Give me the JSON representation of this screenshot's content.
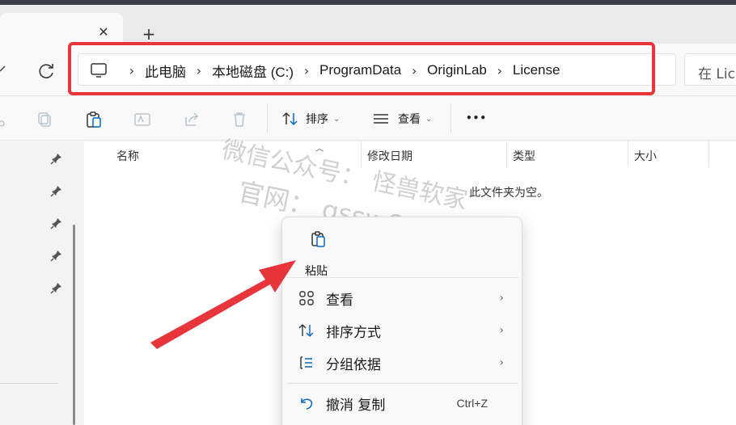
{
  "tab": {
    "close_symbol": "✕",
    "new_symbol": "+"
  },
  "breadcrumbs": [
    "此电脑",
    "本地磁盘 (C:)",
    "ProgramData",
    "OriginLab",
    "License"
  ],
  "breadcrumb_separator": "›",
  "search": {
    "text": "在 Lice"
  },
  "toolbar": {
    "sort_label": "排序",
    "view_label": "查看",
    "more_label": "•••",
    "chevron": "⌄"
  },
  "columns": {
    "name": "名称",
    "modified": "修改日期",
    "type": "类型",
    "size": "大小"
  },
  "empty_message": "此文件夹为空。",
  "context_menu": {
    "paste_label": "粘贴",
    "items": [
      {
        "label": "查看",
        "arrow": "›"
      },
      {
        "label": "排序方式",
        "arrow": "›"
      },
      {
        "label": "分组依据",
        "arrow": "›"
      }
    ],
    "undo_label": "撤消 复制",
    "undo_shortcut": "Ctrl+Z"
  },
  "watermark": {
    "line1": "微信公众号：  怪兽软家",
    "line2": "官网：  gssw66.com"
  },
  "colors": {
    "highlight": "#e8343b",
    "accent": "#0067c0"
  }
}
